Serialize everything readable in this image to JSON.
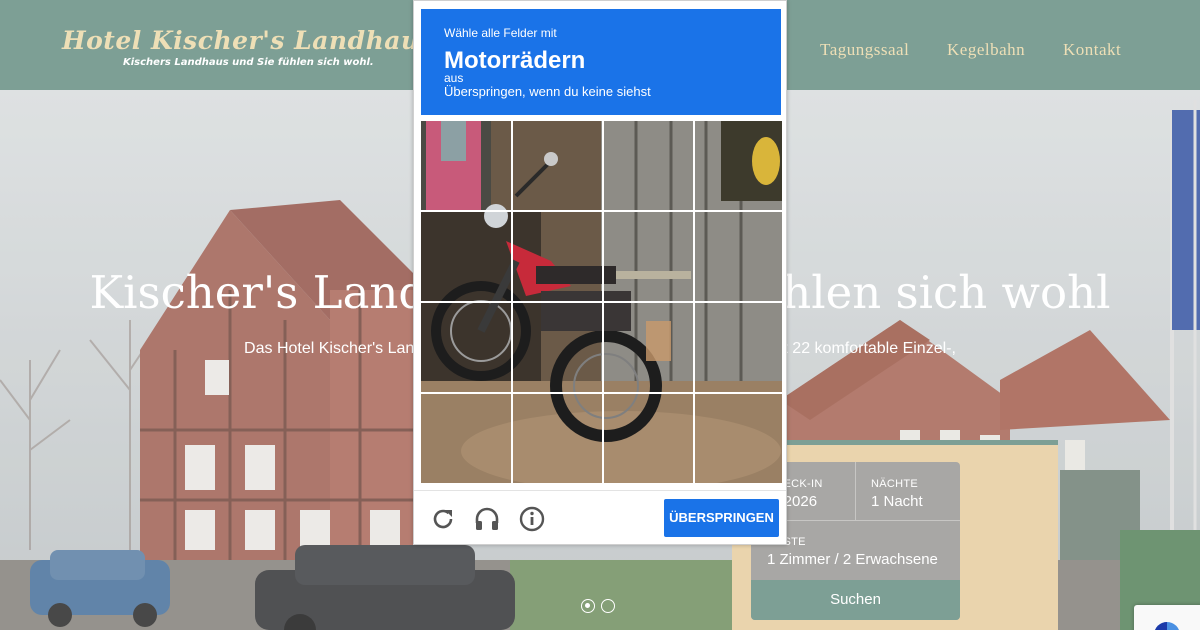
{
  "header": {
    "logo_title": "Hotel Kischer's Landhaus",
    "logo_tagline": "Kischers Landhaus und Sie fühlen sich wohl.",
    "nav": [
      "Tagungssaal",
      "Kegelbahn",
      "Kontakt"
    ]
  },
  "hero": {
    "title": "Kischer's Landhaus und Sie fühlen sich wohl",
    "text": "Das Hotel Kischer's Landhaus liegt zentral in der Region Hannover. Es bietet 22 komfortable Einzel-, Doppel- und Familienzimmer.",
    "slider_dots": 2,
    "active_dot": 1
  },
  "booking": {
    "checkin_label": "CHECK-IN",
    "checkin_value": ".4.2026",
    "nights_label": "NÄCHTE",
    "nights_value": "1 Nacht",
    "guests_label": "GÄSTE",
    "guests_value": "1 Zimmer / 2 Erwachsene",
    "search_label": "Suchen"
  },
  "captcha": {
    "instruction_line1": "Wähle alle Felder mit",
    "object": "Motorrädern",
    "instruction_line3": "aus",
    "instruction_line4": "Überspringen, wenn du keine siehst",
    "grid_size": 4,
    "skip_label": "ÜBERSPRINGEN",
    "icons": [
      "reload-icon",
      "audio-icon",
      "info-icon"
    ]
  },
  "colors": {
    "header_green": "#7d9f95",
    "logo_cream": "#eedfb6",
    "captcha_blue": "#1a73e8",
    "booking_panel": "#ead4ad"
  }
}
